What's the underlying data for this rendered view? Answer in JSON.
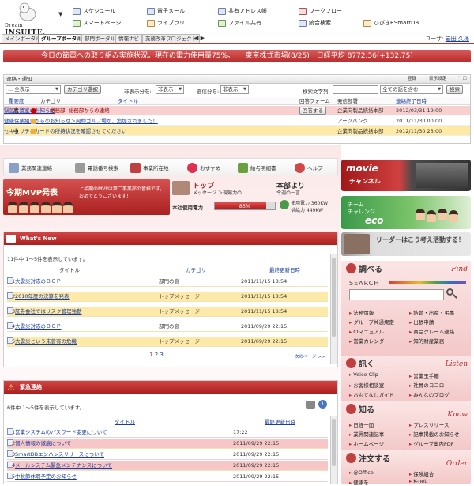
{
  "header": {
    "logo_text": "INSUITE",
    "menu": [
      {
        "label": "スケジュール",
        "icon": "calendar-icon"
      },
      {
        "label": "スマートページ",
        "icon": "smartpage-icon"
      },
      {
        "label": "電子メール",
        "icon": "mail-icon"
      },
      {
        "label": "ライブラリ",
        "icon": "library-icon"
      },
      {
        "label": "共有アドレス帳",
        "icon": "address-book-icon"
      },
      {
        "label": "ファイル共有",
        "icon": "file-share-icon"
      },
      {
        "label": "ワークフロー",
        "icon": "workflow-icon"
      },
      {
        "label": "統合検索",
        "icon": "search-icon"
      },
      {
        "label": "ひびきRSmartDB",
        "icon": "database-icon"
      }
    ]
  },
  "tabs": [
    "メインポータル",
    "グループポータル",
    "部門ポータル",
    "情報ナビ",
    "業務改革プロジェクト"
  ],
  "user": {
    "label": "ユーザ:",
    "name": "岩田 久孫"
  },
  "ticker": "今日の節電への取り組み実施状況。現在の電力使用量75%。　　東京株式市場(8/25)　日経平均 8772.36(+132.75)",
  "notice": {
    "title": "連絡・通知",
    "header_buttons": [
      "登録",
      "表示設定"
    ],
    "filter_value": "全表示",
    "category_button": "カテゴリ選択",
    "hidden_label": "非表示分を:",
    "hidden_value": "非表示",
    "transfer_label": "遡信分を:",
    "transfer_value": "非表示",
    "search_label": "検索文字列",
    "search_scope": "全ての語を含む",
    "search_button": "検索",
    "columns": [
      "重要度",
      "カテゴリ",
      "タイトル",
      "回答フォーム",
      "発信部署",
      "連絡終了日時"
    ],
    "rows": [
      {
        "priority": "高",
        "title": "総務部: 総務部からの連絡",
        "link": "緊急会議室のお知らせ",
        "form": "回答する",
        "dept": "企業向製品統括本部",
        "date": "2012/03/31 19:00"
      },
      {
        "priority": "",
        "title": "",
        "link": "健康保険組合からのお知らせ＞契約ゴルフ場が、追加されました！",
        "form": "",
        "dept": "アーツバンク",
        "date": "2011/11/30 00:00"
      },
      {
        "priority": "中",
        "title": "",
        "link": "セキュリティカードの所持状況を確認させてください",
        "form": "",
        "dept": "企業向製品統括本部",
        "date": "2012/11/30 23:00"
      }
    ]
  },
  "features": [
    "業務関連連絡",
    "電話番号検索",
    "事業所在地",
    "おすすめ",
    "給与明細書",
    "ヘルプ"
  ],
  "mvp": {
    "title": "今期MVP発表",
    "text": "上半期のMVPは第二事業部の皆様です。おめでとうございます！"
  },
  "top_message": {
    "title": "トップ",
    "subtitle": "メッセージ",
    "desc": "＞現場力の",
    "name": "本部より",
    "subname": "今週の一言"
  },
  "power": {
    "label": "本社使用電力",
    "percent_text": "85%",
    "percent": 0.85,
    "usage": "使用電力 360KW",
    "supply": "供給力 449KW"
  },
  "whats_new": {
    "title": "What's New",
    "count": "11件中 1〜5件を表示しています。",
    "columns": [
      "タイトル",
      "カテゴリ",
      "最終更新日時"
    ],
    "rows": [
      {
        "n": "1",
        "title": "大震災対応のＢＣＰ",
        "cat": "部門の窓",
        "date": "2011/11/15 18:54"
      },
      {
        "n": "2",
        "title": "2010年度の決算を発表",
        "cat": "トップメッセージ",
        "date": "2011/11/15 18:54"
      },
      {
        "n": "3",
        "title": "証券会社ではリスク管理強動",
        "cat": "トップメッセージ",
        "date": "2011/11/15 18:54"
      },
      {
        "n": "4",
        "title": "大震災対応のＢＣＰ",
        "cat": "部門の窓",
        "date": "2011/09/29 22:15"
      },
      {
        "n": "5",
        "title": "大震災という未曾有の危機",
        "cat": "トップメッセージ",
        "date": "2011/09/29 22:15"
      }
    ],
    "pages": [
      "1",
      "2",
      "3"
    ],
    "next": "次のページ >>"
  },
  "urgent": {
    "title": "緊急連絡",
    "count": "6件中 1〜5件を表示しています。",
    "columns": [
      "タイトル",
      "最終更新日時"
    ],
    "rows": [
      {
        "n": "1",
        "title": "営業システムのパスワード変更について",
        "date": "17:22"
      },
      {
        "n": "2",
        "title": "個人情報の徹底について",
        "date": "2011/09/29 22:15"
      },
      {
        "n": "3",
        "title": "SmartDBエンハンスリリースについて",
        "date": "2011/09/29 22:15"
      },
      {
        "n": "4",
        "title": "メールシステム緊急メンテナンスについて",
        "date": "2011/09/29 22:15"
      },
      {
        "n": "5",
        "title": "中秋節休暇予定のお知らせ",
        "date": "2011/09/29 22:15"
      }
    ]
  },
  "right": {
    "movie": {
      "title": "movie",
      "sub": "チャンネル"
    },
    "eco": {
      "title": "チーム",
      "sub": "チャレンジ",
      "word": "eco"
    },
    "leader": "リーダーはこう考え活動する！",
    "search": {
      "title": "調べる",
      "en": "Find",
      "label": "SEARCH"
    },
    "find_links": [
      "法務情報",
      "結婚・出産・弔事",
      "グループ共通規定",
      "出張申請",
      "CIマニュアル",
      "商品クレーム連絡",
      "営業カレンダー",
      "知的財産業務"
    ],
    "listen": {
      "title": "訊く",
      "en": "Listen",
      "links": [
        "Voice Clip",
        "営業玉手箱",
        "お客様相談室",
        "社員のココロ",
        "おもてなしガイド",
        "みんなのブログ"
      ]
    },
    "know": {
      "title": "知る",
      "en": "Know",
      "links": [
        "日経一面",
        "プレスリリース",
        "業界関連記事",
        "記事掲載のお知らせ",
        "ホームページ",
        "グループ案内PDF"
      ]
    },
    "order": {
      "title": "注文する",
      "en": "Order",
      "links": [
        "@Office",
        "保険組合",
        "健康を",
        "K-net"
      ]
    }
  }
}
